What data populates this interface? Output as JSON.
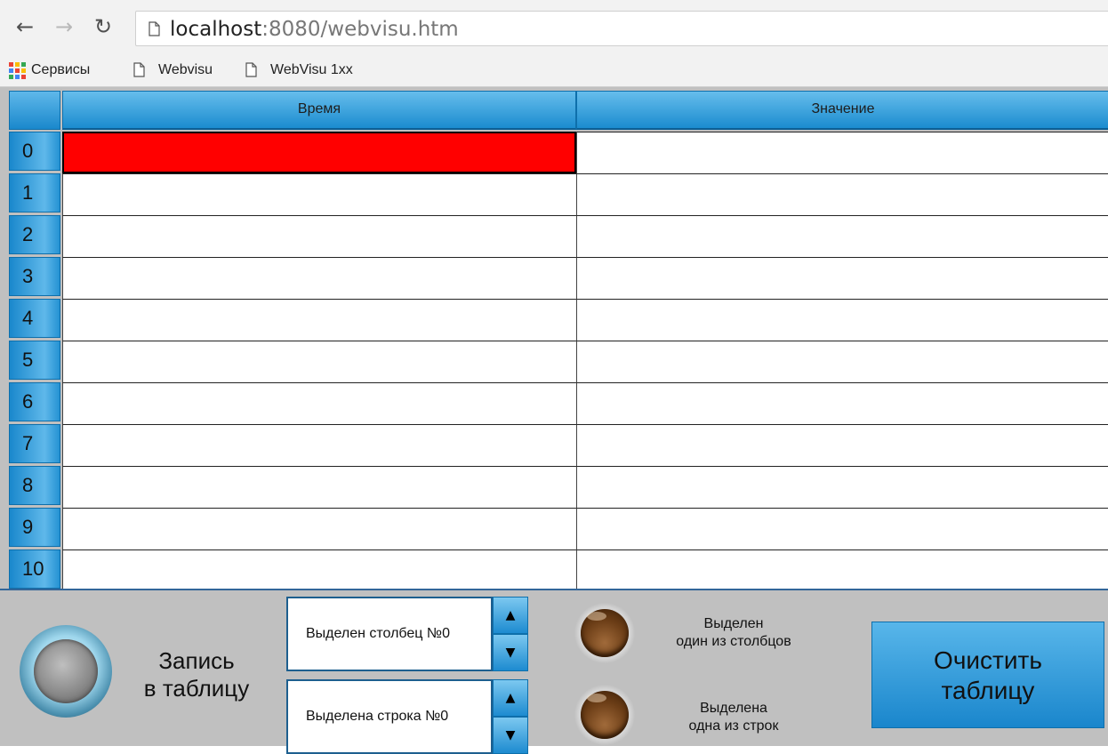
{
  "browser": {
    "url_host": "localhost",
    "url_path": ":8080/webvisu.htm",
    "bookmarks": [
      "Сервисы",
      "Webvisu",
      "WebVisu 1xx"
    ]
  },
  "table": {
    "columns": [
      "Время",
      "Значение"
    ],
    "rows": [
      "0",
      "1",
      "2",
      "3",
      "4",
      "5",
      "6",
      "7",
      "8",
      "9",
      "10"
    ],
    "selected_cell": {
      "row": "0",
      "column": "Время"
    }
  },
  "panel": {
    "record_label_line1": "Запись",
    "record_label_line2": "в таблицу",
    "column_spinner_value": "Выделен столбец №0",
    "row_spinner_value": "Выделена строка №0",
    "lamp1_line1": "Выделен",
    "lamp1_line2": "один из столбцов",
    "lamp2_line1": "Выделена",
    "lamp2_line2": "одна из строк",
    "clear_line1": "Очистить",
    "clear_line2": "таблицу"
  },
  "colors": {
    "header_blue": "#1a88cc",
    "selected_cell": "#ff0000",
    "panel_gray": "#c0c0c0"
  }
}
